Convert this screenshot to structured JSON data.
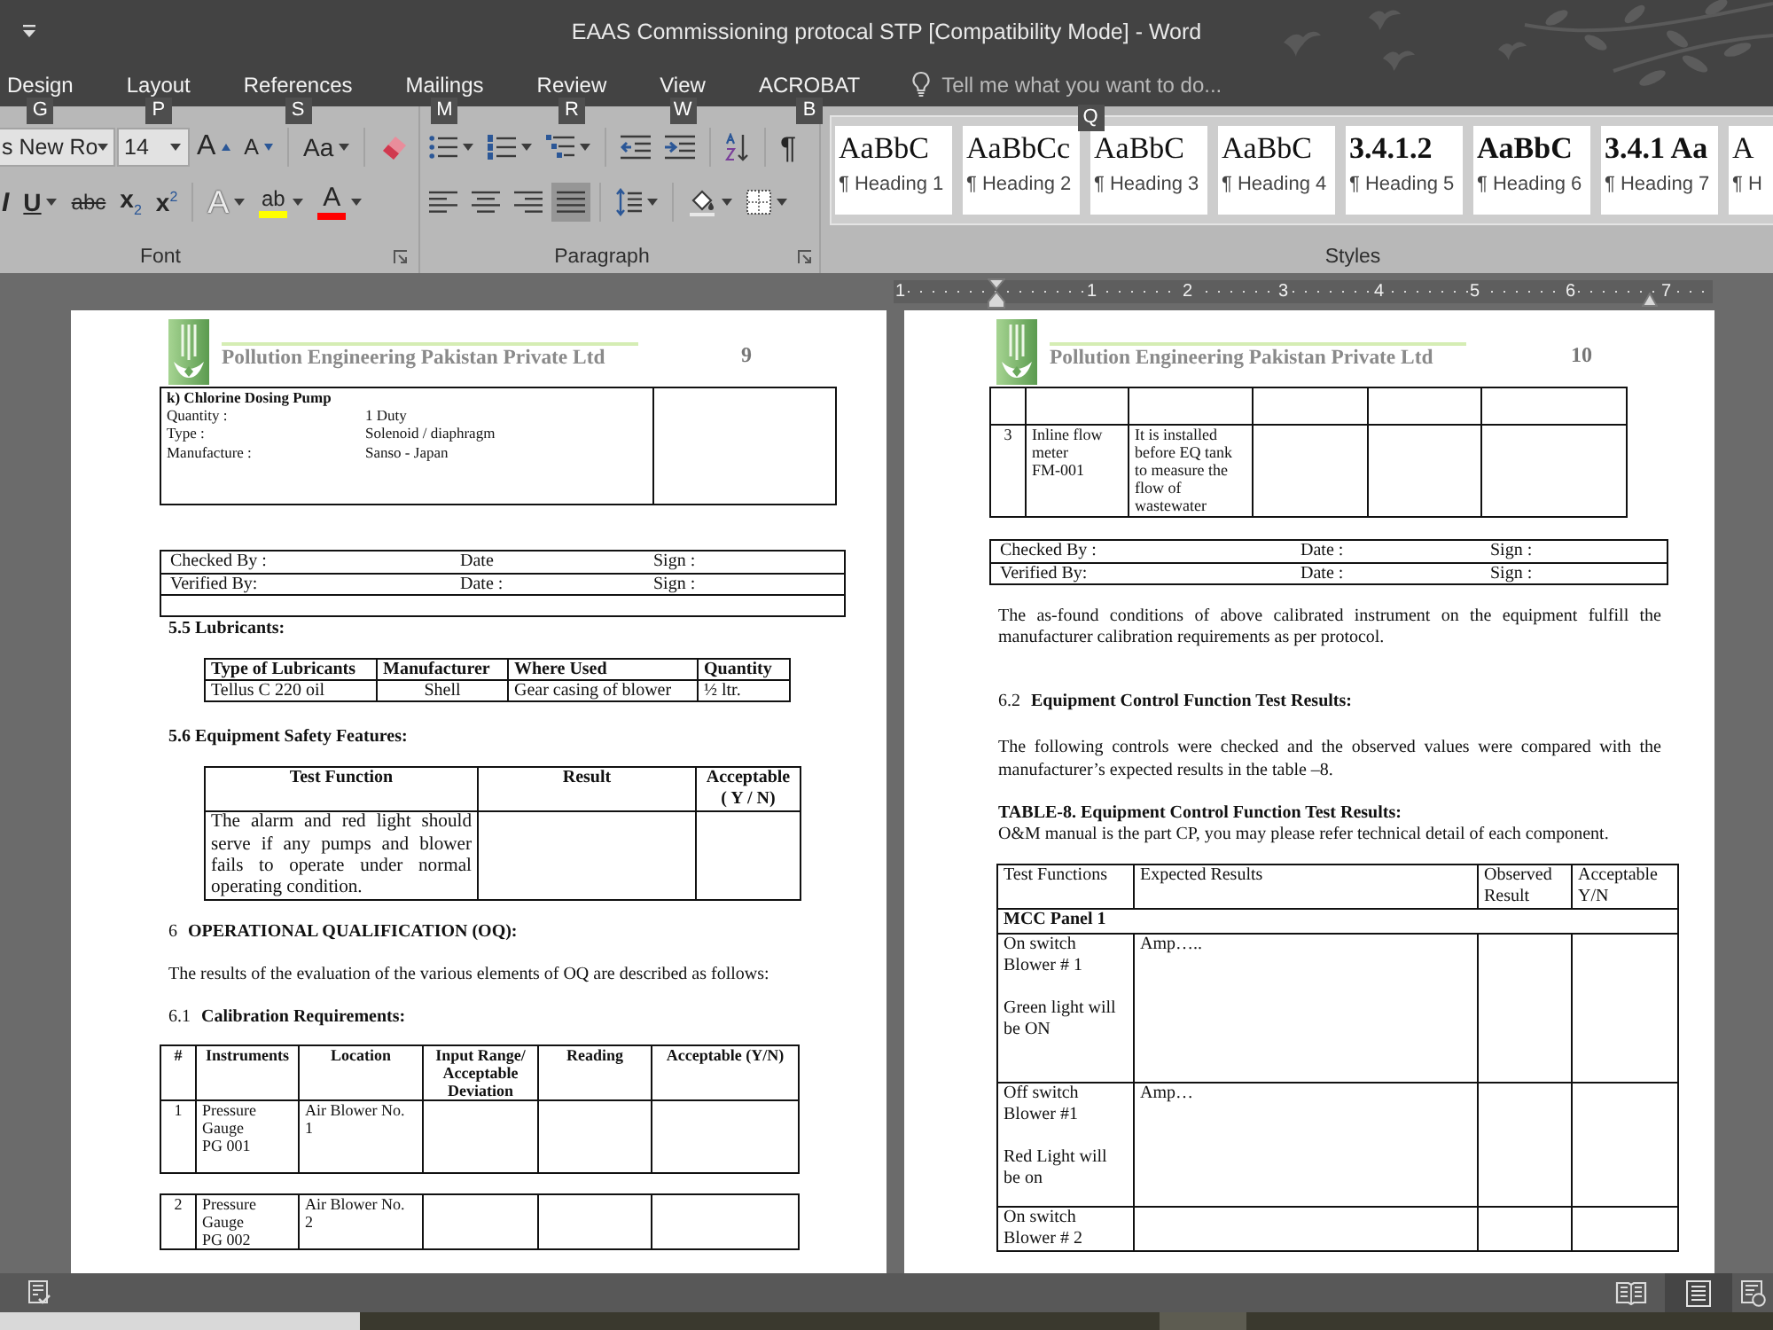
{
  "window": {
    "title": "EAAS Commissioning protocal STP [Compatibility Mode] - Word"
  },
  "tabs": [
    {
      "label": "Design",
      "keytip": "G"
    },
    {
      "label": "Layout",
      "keytip": "P"
    },
    {
      "label": "References",
      "keytip": "S"
    },
    {
      "label": "Mailings",
      "keytip": "M"
    },
    {
      "label": "Review",
      "keytip": "R"
    },
    {
      "label": "View",
      "keytip": "W"
    },
    {
      "label": "ACROBAT",
      "keytip": "B"
    }
  ],
  "tell_me": {
    "placeholder": "Tell me what you want to do...",
    "keytip": "Q"
  },
  "font_group": {
    "label": "Font",
    "font_name": "s New Ro",
    "font_size": "14",
    "row1": [
      {
        "kind": "grow",
        "glyph": "A"
      },
      {
        "kind": "shrink",
        "glyph": "A"
      },
      {
        "kind": "case",
        "glyph": "Aa"
      },
      {
        "kind": "clear"
      }
    ],
    "row2": [
      {
        "kind": "italic",
        "glyph": "I"
      },
      {
        "kind": "underline",
        "glyph": "U"
      },
      {
        "kind": "strike",
        "glyph": "abc"
      },
      {
        "kind": "subscript",
        "glyph": "x$_{2}$"
      },
      {
        "kind": "superscript",
        "glyph": "x$^{2}$"
      },
      {
        "kind": "effects",
        "glyph": "A"
      },
      {
        "kind": "highlight",
        "glyph": "ab",
        "color": "#ffff00"
      },
      {
        "kind": "color",
        "glyph": "A",
        "color": "#ff0000"
      }
    ]
  },
  "paragraph_group": {
    "label": "Paragraph",
    "pilcrow": "¶",
    "alignments": [
      {
        "selected": false
      },
      {
        "selected": false
      },
      {
        "selected": false
      },
      {
        "selected": true
      }
    ]
  },
  "styles_group": {
    "label": "Styles",
    "items": [
      {
        "preview": "AaBbC",
        "name": "¶ Heading 1",
        "bold": false
      },
      {
        "preview": "AaBbCc",
        "name": "¶ Heading 2",
        "bold": false
      },
      {
        "preview": "AaBbC",
        "name": "¶ Heading 3",
        "bold": false
      },
      {
        "preview": "AaBbC",
        "name": "¶ Heading 4",
        "bold": false
      },
      {
        "preview": "3.4.1.2",
        "name": "¶ Heading 5",
        "bold": true
      },
      {
        "preview": "AaBbC",
        "name": "¶ Heading 6",
        "bold": true
      },
      {
        "preview": "3.4.1 Aa",
        "name": "¶ Heading 7",
        "bold": true
      },
      {
        "preview": "A",
        "name": "¶ H",
        "bold": false
      }
    ]
  },
  "ruler": {
    "labels": [
      "1",
      "1",
      "2",
      "3",
      "4",
      "5",
      "6",
      "7"
    ]
  },
  "pages": [
    {
      "company": "Pollution Engineering Pakistan Private Ltd",
      "page_number": "9",
      "blocks": [
        {
          "kind": "spec_box",
          "title": "k) Chlorine Dosing Pump",
          "specs": [
            {
              "label": "Quantity :",
              "value": "1 Duty"
            },
            {
              "label": "Type :",
              "value": "Solenoid / diaphragm"
            },
            {
              "label": "Manufacture :",
              "value": "Sanso - Japan"
            }
          ]
        },
        {
          "kind": "sign_table",
          "rows": [
            [
              "Checked By :",
              "Date",
              "Sign :"
            ],
            [
              "Verified By:",
              "Date :",
              "Sign :"
            ]
          ],
          "blank_row": true
        },
        {
          "kind": "heading",
          "text": "5.5 Lubricants:"
        },
        {
          "kind": "lubricants_table",
          "columns": [
            "Type of Lubricants",
            "Manufacturer",
            "Where Used",
            "Quantity"
          ],
          "rows": [
            [
              "Tellus C 220 oil",
              "Shell",
              "Gear casing of blower",
              "½ ltr."
            ]
          ]
        },
        {
          "kind": "heading",
          "text": "5.6 Equipment Safety Features:"
        },
        {
          "kind": "safety_table",
          "columns": [
            "Test Function",
            "Result",
            "Acceptable\n( Y / N)"
          ],
          "rows": [
            [
              "The alarm and red light should serve if any pumps and blower fails to operate under normal operating condition."
            ]
          ]
        },
        {
          "kind": "heading",
          "number": "6",
          "text": "OPERATIONAL QUALIFICATION (OQ):"
        },
        {
          "kind": "paragraph",
          "text": "The results of the evaluation of the various elements of OQ are described as follows:"
        },
        {
          "kind": "heading",
          "number": "6.1",
          "text": "Calibration Requirements:"
        },
        {
          "kind": "calibration_table",
          "columns": [
            "#",
            "Instruments",
            "Location",
            "Input Range/\nAcceptable\nDeviation",
            "Reading",
            "Acceptable (Y/N)"
          ],
          "rows": [
            [
              "1",
              "Pressure\nGauge\nPG 001",
              "Air Blower No.\n1"
            ]
          ]
        },
        {
          "kind": "calibration_table",
          "rows": [
            [
              "2",
              "Pressure\nGauge\nPG 002",
              "Air Blower No.\n2"
            ]
          ]
        }
      ]
    },
    {
      "company": "Pollution Engineering Pakistan Private Ltd",
      "page_number": "10",
      "blocks": [
        {
          "kind": "calibration_table",
          "blank_header": true,
          "rows": [
            [
              "3",
              "Inline flow\nmeter\nFM-001",
              "It is installed\nbefore EQ tank\nto measure the\nflow of\nwastewater"
            ]
          ]
        },
        {
          "kind": "sign_table",
          "rows": [
            [
              "Checked By :",
              "Date :",
              "Sign :"
            ],
            [
              "Verified By:",
              "Date :",
              "Sign :"
            ]
          ]
        },
        {
          "kind": "paragraph",
          "text": "The as-found conditions of above calibrated instrument on the equipment fulfill the manufacturer calibration requirements as per protocol."
        },
        {
          "kind": "heading",
          "number": "6.2",
          "text": "Equipment Control Function Test Results:"
        },
        {
          "kind": "paragraph",
          "text": "The following controls were checked and the observed values were compared with the manufacturer’s expected results in the table –8."
        },
        {
          "kind": "heading",
          "text": "TABLE-8. Equipment Control Function Test Results:"
        },
        {
          "kind": "paragraph",
          "text": "O&M manual is the part CP, you may please refer technical detail of each component."
        },
        {
          "kind": "function_table",
          "columns": [
            "Test Functions",
            "Expected Results",
            "Observed\nResult",
            "Acceptable\nY/N"
          ],
          "rows": [
            {
              "kind": "section",
              "label": "MCC Panel 1"
            },
            {
              "kind": "row",
              "cells": [
                "On switch\nBlower # 1\n\nGreen light will\nbe ON",
                "Amp….."
              ]
            },
            {
              "kind": "row",
              "cells": [
                "Off switch\nBlower #1\n\nRed Light will\nbe on",
                "Amp…"
              ]
            },
            {
              "kind": "row",
              "cells": [
                "On switch\nBlower # 2"
              ]
            }
          ]
        }
      ]
    }
  ],
  "status_bar": {
    "views": [
      {
        "selected": false
      },
      {
        "selected": true
      },
      {
        "selected": false
      }
    ]
  }
}
